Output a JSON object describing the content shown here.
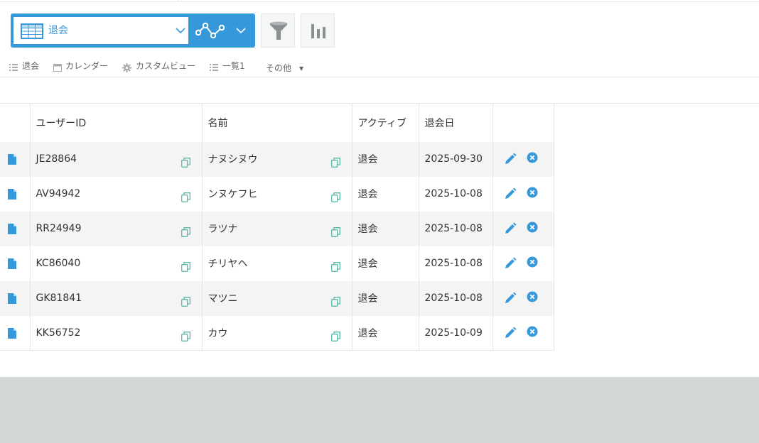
{
  "view_selector": {
    "current_view": "退会"
  },
  "view_links": [
    {
      "label": "退会",
      "icon": "list-icon"
    },
    {
      "label": "カレンダー",
      "icon": "calendar-icon"
    },
    {
      "label": "カスタムビュー",
      "icon": "gear-icon"
    },
    {
      "label": "一覧1",
      "icon": "list-icon"
    },
    {
      "label": "その他",
      "icon": "caret-down-icon"
    }
  ],
  "table": {
    "columns": [
      "ユーザーID",
      "名前",
      "アクティブ",
      "退会日"
    ],
    "rows": [
      {
        "user_id": "JE28864",
        "name": "ナヌシヌウ",
        "active": "退会",
        "date": "2025-09-30"
      },
      {
        "user_id": "AV94942",
        "name": "ンヌケフヒ",
        "active": "退会",
        "date": "2025-10-08"
      },
      {
        "user_id": "RR24949",
        "name": "ラツナ",
        "active": "退会",
        "date": "2025-10-08"
      },
      {
        "user_id": "KC86040",
        "name": "チリヤヘ",
        "active": "退会",
        "date": "2025-10-08"
      },
      {
        "user_id": "GK81841",
        "name": "マツニ",
        "active": "退会",
        "date": "2025-10-08"
      },
      {
        "user_id": "KK56752",
        "name": "カウ",
        "active": "退会",
        "date": "2025-10-09"
      }
    ]
  },
  "colors": {
    "accent": "#3498db",
    "copy_icon": "#5bb8a6",
    "footer_bg": "#d4d7d8",
    "row_alt": "#f4f4f4"
  }
}
